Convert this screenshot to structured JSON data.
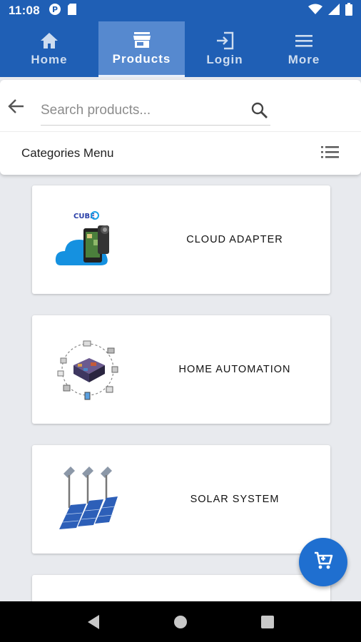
{
  "status_bar": {
    "time": "11:08",
    "icons": [
      "pokeball-icon",
      "sd-card-icon",
      "wifi-icon",
      "signal-icon",
      "battery-icon"
    ]
  },
  "nav": {
    "tabs": [
      {
        "label": "Home",
        "icon": "home-icon",
        "active": false
      },
      {
        "label": "Products",
        "icon": "store-icon",
        "active": true
      },
      {
        "label": "Login",
        "icon": "login-icon",
        "active": false
      },
      {
        "label": "More",
        "icon": "menu-icon",
        "active": false
      }
    ]
  },
  "search": {
    "placeholder": "Search products...",
    "value": ""
  },
  "categories": {
    "label": "Categories Menu"
  },
  "products": [
    {
      "name": "CLOUD ADAPTER",
      "image": "cloud-adapter-image"
    },
    {
      "name": "HOME AUTOMATION",
      "image": "home-automation-image"
    },
    {
      "name": "SOLAR SYSTEM",
      "image": "solar-system-image"
    }
  ],
  "cloud_logo_text": "CUBE",
  "fab": {
    "icon": "cart-icon"
  },
  "colors": {
    "primary": "#1f5fb5",
    "active_tab": "#5689cf",
    "fab": "#1f6fd0",
    "background": "#e8eaee"
  }
}
